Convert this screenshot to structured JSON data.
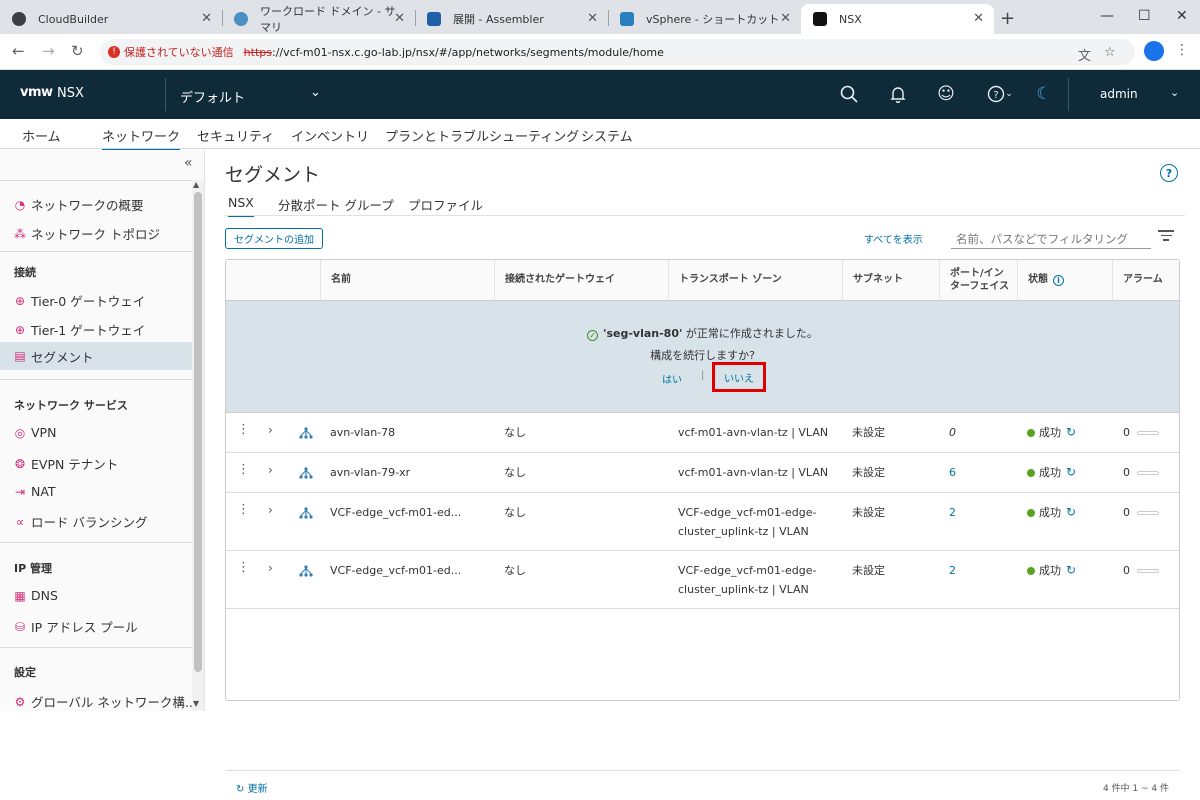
{
  "browser": {
    "tabs": [
      {
        "label": "CloudBuilder",
        "color": "#3c4043"
      },
      {
        "label": "ワークロード ドメイン - サマリ",
        "color": "#4a90c2"
      },
      {
        "label": "展開 - Assembler",
        "color": "#1f5fa8"
      },
      {
        "label": "vSphere - ショートカット",
        "color": "#2a7fbf"
      },
      {
        "label": "NSX",
        "color": "#111111"
      }
    ],
    "security_label": "保護されていない通信",
    "url_scheme": "https",
    "url_rest": "://vcf-m01-nsx.c.go-lab.jp/nsx/#/app/networks/segments/module/home"
  },
  "header": {
    "logo": "vmw",
    "app_name": "NSX",
    "project": "デフォルト",
    "user": "admin"
  },
  "main_nav": [
    "ホーム",
    "ネットワーク",
    "セキュリティ",
    "インベントリ",
    "プランとトラブルシューティング",
    "システム"
  ],
  "sidebar": {
    "top_items": [
      "ネットワークの概要",
      "ネットワーク トポロジ"
    ],
    "section_connection": "接続",
    "connection_items": [
      "Tier-0 ゲートウェイ",
      "Tier-1 ゲートウェイ",
      "セグメント"
    ],
    "section_services": "ネットワーク サービス",
    "service_items": [
      "VPN",
      "EVPN テナント",
      "NAT",
      "ロード バランシング"
    ],
    "section_ip": "IP 管理",
    "ip_items": [
      "DNS",
      "IP アドレス プール"
    ],
    "section_settings": "設定",
    "settings_items": [
      "グローバル ネットワーク構..."
    ]
  },
  "page": {
    "title": "セグメント",
    "subtabs": [
      "NSX",
      "分散ポート グループ",
      "プロファイル"
    ],
    "add_button": "セグメントの追加",
    "show_all": "すべてを表示",
    "filter_placeholder": "名前、パスなどでフィルタリング"
  },
  "grid": {
    "columns": [
      "名前",
      "接続されたゲートウェイ",
      "トランスポート ゾーン",
      "サブネット",
      "ポート/イン ターフェイス",
      "状態",
      "アラーム"
    ],
    "banner_created_name": "'seg-vlan-80'",
    "banner_created_suffix": " が正常に作成されました。",
    "banner_question": "構成を続行しますか?",
    "yes": "はい",
    "pipe": "|",
    "no": "いいえ",
    "rows": [
      {
        "name": "avn-vlan-78",
        "gateway": "なし",
        "tz1": "vcf-m01-avn-vlan-tz | VLAN",
        "tz2": "",
        "subnet": "未設定",
        "ports": "0",
        "status": "成功",
        "alarms": "0"
      },
      {
        "name": "avn-vlan-79-xr",
        "gateway": "なし",
        "tz1": "vcf-m01-avn-vlan-tz | VLAN",
        "tz2": "",
        "subnet": "未設定",
        "ports": "6",
        "status": "成功",
        "alarms": "0"
      },
      {
        "name": "VCF-edge_vcf-m01-ed...",
        "gateway": "なし",
        "tz1": "VCF-edge_vcf-m01-edge-",
        "tz2": "cluster_uplink-tz | VLAN",
        "subnet": "未設定",
        "ports": "2",
        "status": "成功",
        "alarms": "0"
      },
      {
        "name": "VCF-edge_vcf-m01-ed...",
        "gateway": "なし",
        "tz1": "VCF-edge_vcf-m01-edge-",
        "tz2": "cluster_uplink-tz | VLAN",
        "subnet": "未設定",
        "ports": "2",
        "status": "成功",
        "alarms": "0"
      }
    ],
    "refresh": "更新",
    "pager": "4 件中 1 ~ 4 件"
  },
  "colors": {
    "header_bg": "#0f2a38",
    "accent": "#0072a3",
    "success": "#5aa220",
    "highlight_box": "#e00000"
  }
}
